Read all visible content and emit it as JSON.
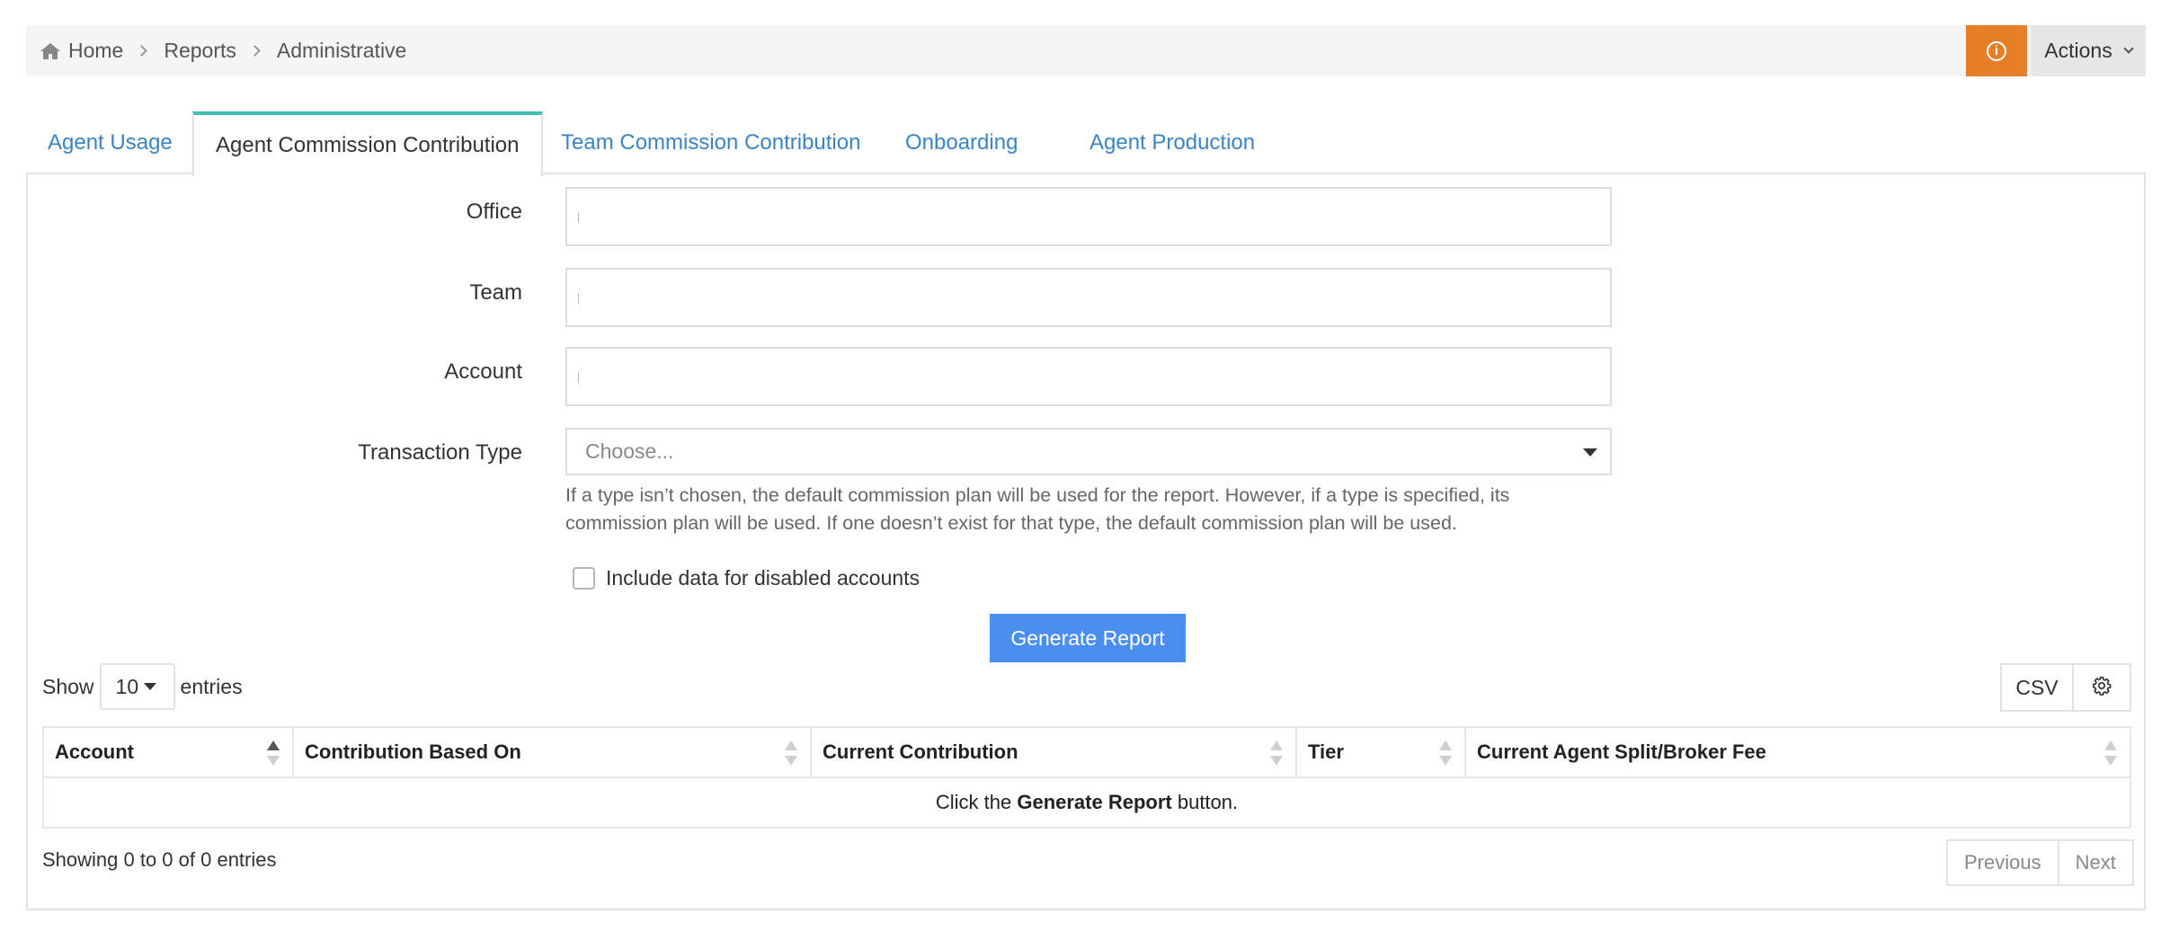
{
  "breadcrumb": {
    "icon": "home-icon",
    "items": [
      "Home",
      "Reports",
      "Administrative"
    ]
  },
  "header": {
    "info_icon": "info-circle-icon",
    "info_color": "#e47f28",
    "actions_label": "Actions"
  },
  "tabs": [
    {
      "label": "Agent Usage",
      "active": false
    },
    {
      "label": "Agent Commission Contribution",
      "active": true
    },
    {
      "label": "Team Commission Contribution",
      "active": false
    },
    {
      "label": "Onboarding",
      "active": false
    },
    {
      "label": "Agent Production",
      "active": false
    }
  ],
  "form": {
    "office_label": "Office",
    "office_value": "",
    "team_label": "Team",
    "team_value": "",
    "account_label": "Account",
    "account_value": "",
    "transaction_type_label": "Transaction Type",
    "transaction_type_placeholder": "Choose...",
    "help_text": "If a type isn’t chosen, the default commission plan will be used for the report. However, if a type is specified, its commission plan will be used. If one doesn’t exist for that type, the default commission plan will be used.",
    "include_disabled_label": "Include data for disabled accounts",
    "include_disabled_checked": false,
    "generate_label": "Generate Report"
  },
  "table_controls": {
    "show_label": "Show",
    "page_length": "10",
    "entries_label": "entries",
    "csv_label": "CSV",
    "settings_icon": "gear-icon"
  },
  "table": {
    "columns": [
      "Account",
      "Contribution Based On",
      "Current Contribution",
      "Tier",
      "Current Agent Split/Broker Fee"
    ],
    "empty_prefix": "Click the ",
    "empty_bold": "Generate Report",
    "empty_suffix": " button."
  },
  "footer": {
    "info": "Showing 0 to 0 of 0 entries",
    "previous_label": "Previous",
    "next_label": "Next"
  },
  "colors": {
    "link": "#3b84c4",
    "active_tab_border": "#3fbdb0",
    "primary_button": "#4a8ff0"
  }
}
